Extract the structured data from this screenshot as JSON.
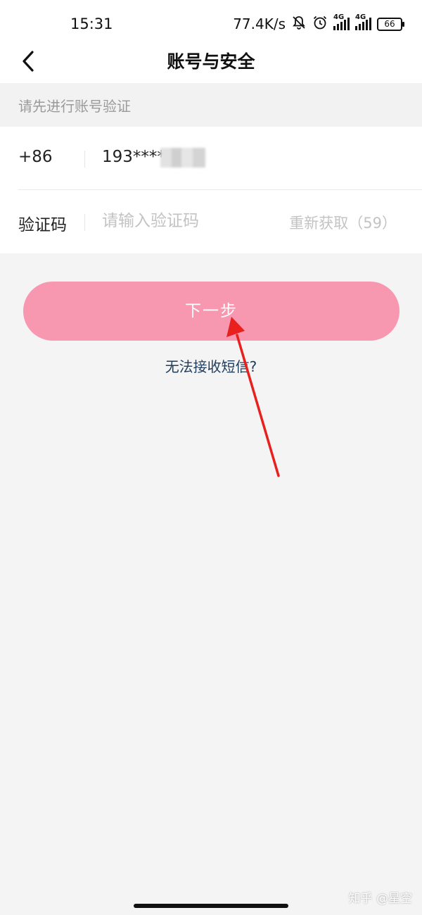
{
  "status_bar": {
    "time": "15:31",
    "network_speed": "77.4K/s",
    "signal_1_label": "4G",
    "signal_2_label": "4G",
    "battery_level": "66"
  },
  "header": {
    "title": "账号与安全",
    "back_icon": "chevron-left-icon"
  },
  "hint": "请先进行账号验证",
  "form": {
    "country_code": "+86",
    "phone_masked": "193****",
    "code_label": "验证码",
    "code_placeholder": "请输入验证码",
    "code_value": "",
    "resend_label": "重新获取（59）"
  },
  "primary_button": {
    "label": "下一步"
  },
  "help_link": "无法接收短信?",
  "watermark": "知乎 @星空",
  "colors": {
    "button_bg": "#f797b0",
    "link": "#1f3c5c",
    "annotation_arrow": "#e8201e"
  }
}
